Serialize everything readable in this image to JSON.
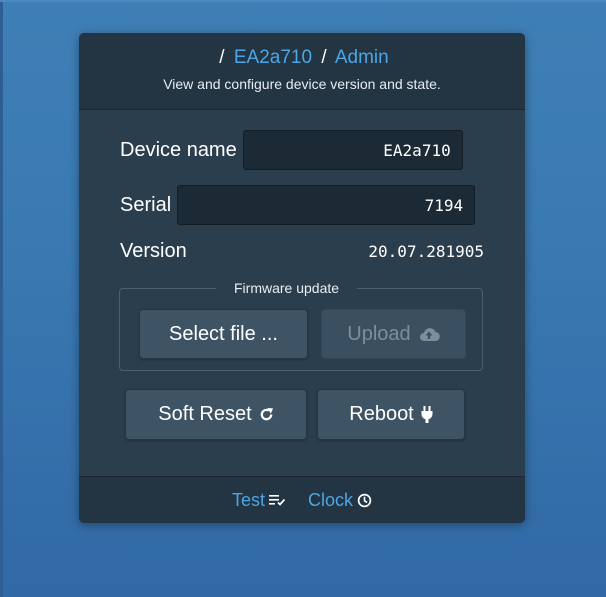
{
  "header": {
    "separator": "/",
    "device": "EA2a710",
    "page": "Admin",
    "subtitle": "View and configure device version and state."
  },
  "form": {
    "device_name_label": "Device name",
    "device_name_value": "EA2a710",
    "serial_label": "Serial",
    "serial_value": "7194",
    "version_label": "Version",
    "version_value": "20.07.281905"
  },
  "firmware": {
    "legend": "Firmware update",
    "select_label": "Select file ...",
    "upload_label": "Upload",
    "upload_icon": "cloud-upload-icon"
  },
  "actions": {
    "soft_reset_label": "Soft Reset",
    "soft_reset_icon": "refresh-icon",
    "reboot_label": "Reboot",
    "reboot_icon": "plug-icon"
  },
  "footer": {
    "test_label": "Test",
    "test_icon": "checklist-icon",
    "clock_label": "Clock",
    "clock_icon": "clock-icon"
  },
  "colors": {
    "background": "#3a79b2",
    "card": "#2b3e4e",
    "link": "#4ba6e8"
  }
}
